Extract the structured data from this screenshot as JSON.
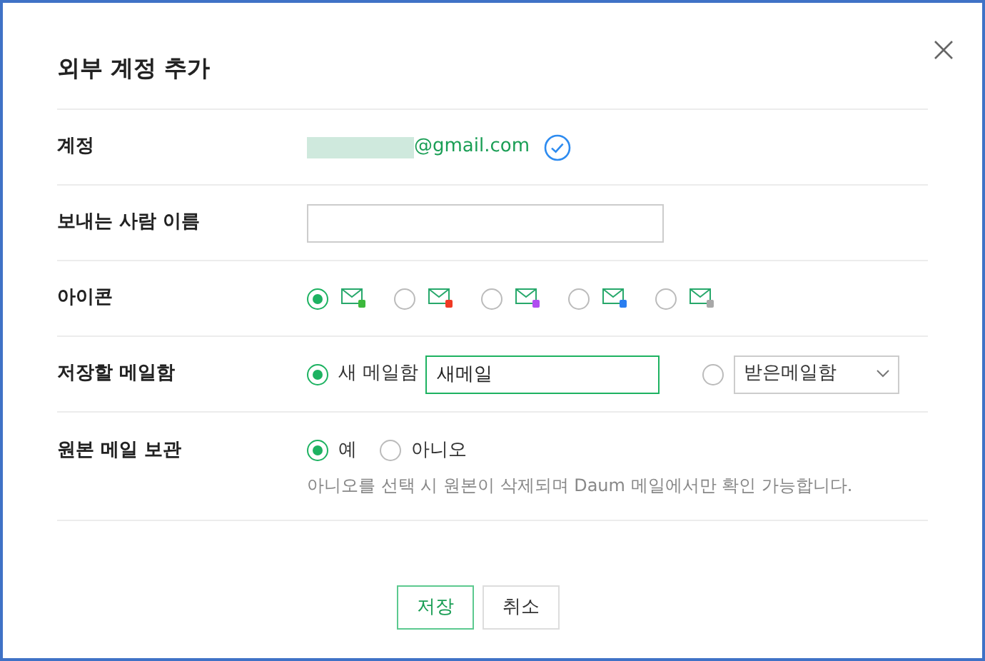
{
  "dialog": {
    "title": "외부 계정 추가"
  },
  "fields": [
    {
      "kind": "account",
      "label": "계정",
      "value": "@gmail.com",
      "verified": true
    },
    {
      "kind": "text",
      "label": "보내는 사람 이름"
    },
    {
      "kind": "icons",
      "label": "아이콘",
      "options": [
        {
          "color": "#3cb83c",
          "selected": true
        },
        {
          "color": "#f03a24",
          "selected": false
        },
        {
          "color": "#b04ef0",
          "selected": false
        },
        {
          "color": "#2a7ef0",
          "selected": false
        },
        {
          "color": "#a8a8a8",
          "selected": false
        }
      ]
    },
    {
      "kind": "folder",
      "label": "저장할 메일함",
      "new_option": {
        "label": "새 메일함",
        "selected": true,
        "value": "새메일"
      },
      "existing_option": {
        "selected": false,
        "value": "받은메일함"
      }
    },
    {
      "kind": "keep",
      "label": "원본 메일 보관",
      "options": [
        {
          "label": "예",
          "selected": true
        },
        {
          "label": "아니오",
          "selected": false
        }
      ],
      "note": "아니오를 선택 시 원본이 삭제되며 Daum 메일에서만 확인 가능합니다."
    }
  ],
  "buttons": [
    {
      "label": "저장",
      "primary": true
    },
    {
      "label": "취소",
      "primary": false
    }
  ]
}
